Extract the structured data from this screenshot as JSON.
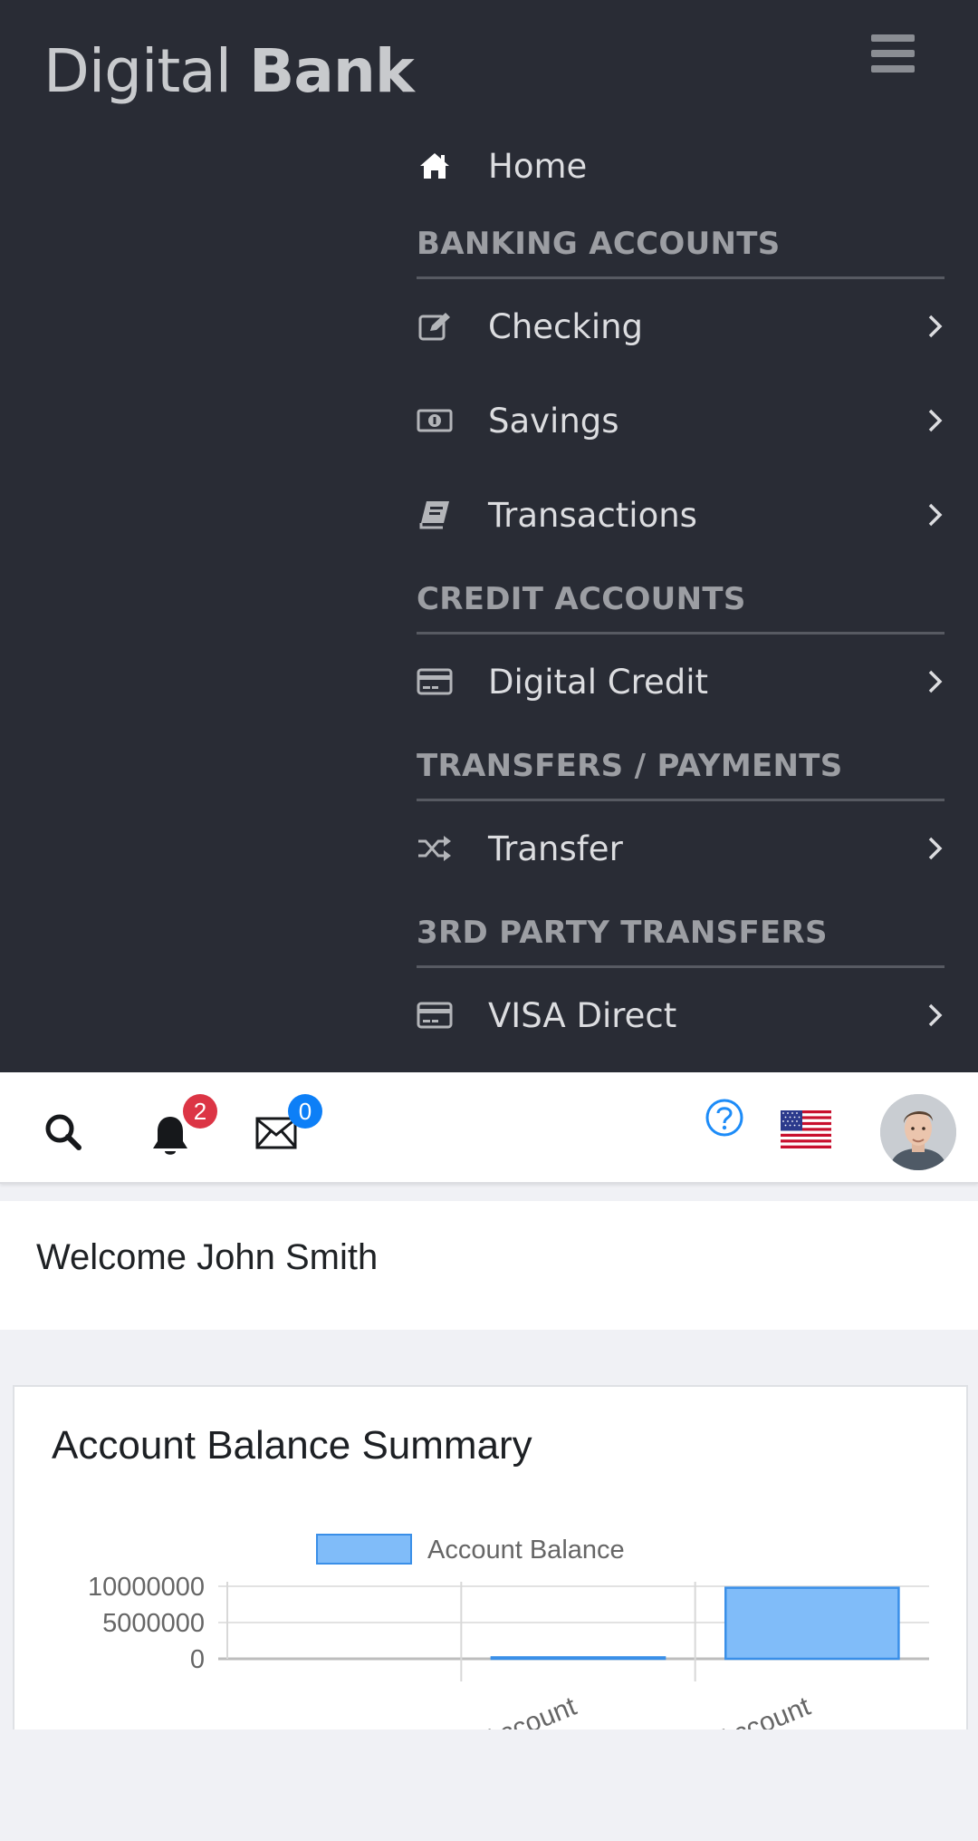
{
  "app": {
    "brand_light": "Digital",
    "brand_bold": "Bank"
  },
  "nav": {
    "home_label": "Home",
    "sections": [
      {
        "title": "BANKING ACCOUNTS",
        "items": [
          {
            "label": "Checking",
            "icon": "edit-icon"
          },
          {
            "label": "Savings",
            "icon": "money-icon"
          },
          {
            "label": "Transactions",
            "icon": "book-icon"
          }
        ]
      },
      {
        "title": "CREDIT ACCOUNTS",
        "items": [
          {
            "label": "Digital Credit",
            "icon": "credit-card-icon"
          }
        ]
      },
      {
        "title": "TRANSFERS / PAYMENTS",
        "items": [
          {
            "label": "Transfer",
            "icon": "shuffle-icon"
          }
        ]
      },
      {
        "title": "3RD PARTY TRANSFERS",
        "items": [
          {
            "label": "VISA Direct",
            "icon": "credit-card-icon"
          }
        ]
      }
    ]
  },
  "toolbar": {
    "notifications_count": "2",
    "messages_count": "0",
    "notification_badge_color": "#dc3545",
    "message_badge_color": "#0d7ff7",
    "help_color": "#1d8cf8"
  },
  "welcome": {
    "text": "Welcome John Smith"
  },
  "card": {
    "title": "Account Balance Summary"
  },
  "chart_data": {
    "type": "bar",
    "legend": [
      "Account Balance"
    ],
    "categories": [
      "Account",
      "Account"
    ],
    "series": [
      {
        "name": "Account Balance",
        "values": [
          0,
          200000,
          9800000
        ]
      }
    ],
    "yticks": [
      "10000000",
      "5000000",
      "0"
    ],
    "ylim": [
      0,
      10000000
    ],
    "bar_color": "#80bcf9",
    "bar_border": "#3a8fe8"
  }
}
